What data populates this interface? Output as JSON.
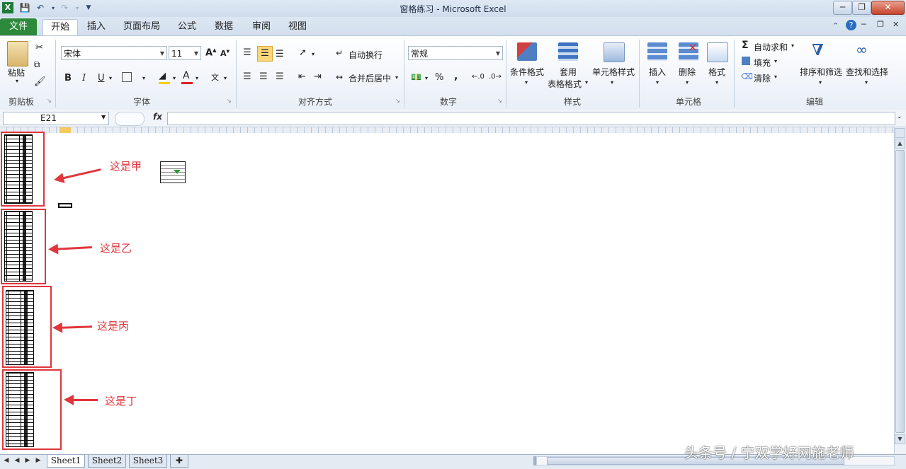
{
  "window": {
    "title": "窗格练习 - Microsoft Excel",
    "controls": [
      "minimize-icon",
      "restore-icon",
      "close-icon"
    ]
  },
  "ribbon": {
    "tabs": [
      "文件",
      "开始",
      "插入",
      "页面布局",
      "公式",
      "数据",
      "审阅",
      "视图"
    ],
    "active_tab": "开始",
    "clipboard": {
      "paste": "粘贴",
      "group": "剪贴板"
    },
    "font": {
      "name": "宋体",
      "size": "11",
      "group": "字体",
      "bold": "B",
      "italic": "I",
      "underline": "U",
      "grow": "A",
      "shrink": "A",
      "color_letter": "A",
      "accent_fill": "#f5d000",
      "accent_font": "#e02020"
    },
    "alignment": {
      "wrap": "自动换行",
      "merge": "合并后居中",
      "group": "对齐方式"
    },
    "number": {
      "format": "常规",
      "percent": "%",
      "comma": ",",
      "group": "数字"
    },
    "styles": {
      "conditional": "条件格式",
      "table_line1": "套用",
      "table_line2": "表格格式",
      "cell_styles": "单元格样式",
      "group": "样式"
    },
    "cells": {
      "insert": "插入",
      "delete": "删除",
      "format": "格式",
      "group": "单元格"
    },
    "editing": {
      "autosum": "自动求和",
      "fill": "填充",
      "clear": "清除",
      "sort": "排序和筛选",
      "find": "查找和选择",
      "group": "编辑",
      "sigma": "Σ"
    }
  },
  "formula_bar": {
    "name_box": "E21",
    "fx": "fx",
    "content": ""
  },
  "annotations": {
    "jia": "这是甲",
    "yi": "这是乙",
    "bing": "这是丙",
    "ding": "这是丁",
    "color": "#e0363c"
  },
  "sheet_tabs": [
    "Sheet1",
    "Sheet2",
    "Sheet3"
  ],
  "active_sheet": "Sheet1",
  "watermark": "头条号 / 宁双学好网施老师"
}
